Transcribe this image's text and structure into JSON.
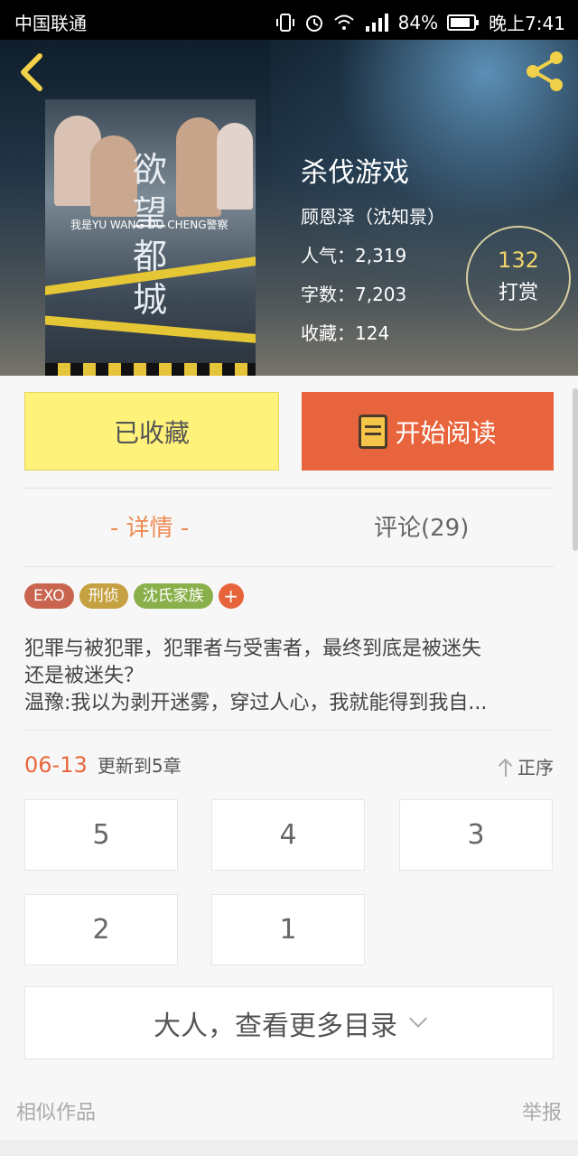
{
  "status_bar": {
    "carrier": "中国联通",
    "battery": "84%",
    "time": "晚上7:41"
  },
  "nav": {
    "back_icon": "back-arrow-icon",
    "share_icon": "share-icon"
  },
  "book": {
    "title": "杀伐游戏",
    "subtitle": "顾恩泽（沈知景）",
    "popularity": "人气：2,319",
    "word_count": "字数：7,203",
    "favorites": "收藏：124"
  },
  "cover": {
    "title_vertical": "欲望都城",
    "subtitle_line": "我是YU WANG DU CHENG警察"
  },
  "tip": {
    "count": "132",
    "label": "打赏"
  },
  "actions": {
    "favorited_label": "已收藏",
    "read_label": "开始阅读"
  },
  "tabs": {
    "detail": "- 详情 -",
    "comments": "评论(29)"
  },
  "tags": [
    {
      "label": "EXO",
      "color": "#c9654f"
    },
    {
      "label": "刑侦",
      "color": "#c5a142"
    },
    {
      "label": "沈氏家族",
      "color": "#89b04a"
    }
  ],
  "tag_add": "+",
  "description": {
    "line1": "犯罪与被犯罪，犯罪者与受害者，最终到底是被迷失",
    "line2": "还是被迷失？",
    "line3": "温豫:我以为剥开迷雾，穿过人心，我就能得到我自..."
  },
  "update": {
    "date": "06-13",
    "text": "更新到5章",
    "order_label": "正序"
  },
  "chapters": [
    "5",
    "4",
    "3",
    "2",
    "1"
  ],
  "more_catalog": "大人，查看更多目录",
  "footer": {
    "similar": "相似作品",
    "report": "举报"
  }
}
